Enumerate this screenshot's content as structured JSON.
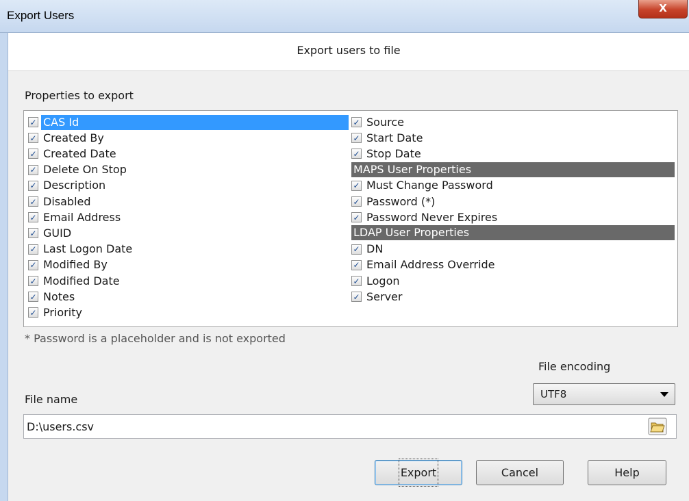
{
  "window": {
    "title": "Export Users",
    "close_label": "X"
  },
  "header": {
    "text": "Export users to file"
  },
  "properties": {
    "label": "Properties to export",
    "left_column": [
      {
        "label": "CAS Id",
        "checked": true,
        "selected": true
      },
      {
        "label": "Created By",
        "checked": true
      },
      {
        "label": "Created Date",
        "checked": true
      },
      {
        "label": "Delete On Stop",
        "checked": true
      },
      {
        "label": "Description",
        "checked": true
      },
      {
        "label": "Disabled",
        "checked": true
      },
      {
        "label": "Email Address",
        "checked": true
      },
      {
        "label": "GUID",
        "checked": true
      },
      {
        "label": "Last Logon Date",
        "checked": true
      },
      {
        "label": "Modified By",
        "checked": true
      },
      {
        "label": "Modified Date",
        "checked": true
      },
      {
        "label": "Notes",
        "checked": true
      },
      {
        "label": "Priority",
        "checked": true
      }
    ],
    "right_column": [
      {
        "label": "Source",
        "checked": true
      },
      {
        "label": "Start Date",
        "checked": true
      },
      {
        "label": "Stop Date",
        "checked": true
      },
      {
        "group": "MAPS User Properties"
      },
      {
        "label": "Must Change Password",
        "checked": true
      },
      {
        "label": "Password (*)",
        "checked": true
      },
      {
        "label": "Password Never Expires",
        "checked": true
      },
      {
        "group": "LDAP User Properties"
      },
      {
        "label": "DN",
        "checked": true
      },
      {
        "label": "Email Address Override",
        "checked": true
      },
      {
        "label": "Logon",
        "checked": true
      },
      {
        "label": "Server",
        "checked": true
      }
    ],
    "footnote": "* Password is a placeholder and is not exported"
  },
  "encoding": {
    "label": "File encoding",
    "value": "UTF8"
  },
  "file": {
    "label": "File name",
    "value": "D:\\users.csv"
  },
  "buttons": {
    "export": "Export",
    "cancel": "Cancel",
    "help": "Help"
  },
  "colors": {
    "selection": "#3399ff",
    "group_header": "#696969",
    "titlebar": "#c6d8ef",
    "close": "#c7432a"
  },
  "icons": {
    "close": "close-icon",
    "browse": "folder-open-icon",
    "checkbox": "checkmark-icon",
    "dropdown": "chevron-down-icon"
  }
}
